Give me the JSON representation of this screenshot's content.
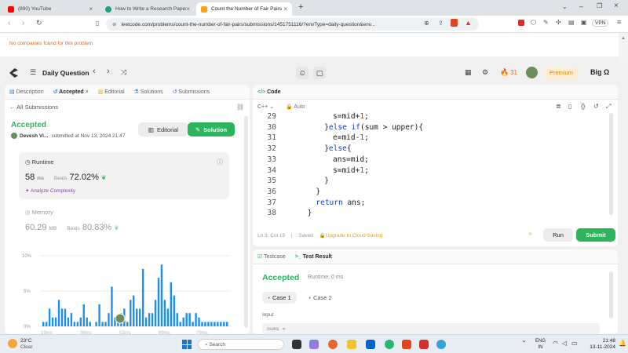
{
  "browser": {
    "tabs": [
      {
        "title": "(890) YouTube"
      },
      {
        "title": "How to Write a Research Paper: A S"
      },
      {
        "title": "Count the Number of Fair Pairs"
      }
    ],
    "url": "leetcode.com/problems/count-the-number-of-fair-pairs/submissions/1451751116/?envType=daily-question&env..."
  },
  "notice": "No companies found for this problem",
  "nav": {
    "daily_question": "Daily Question",
    "streak": "31",
    "premium": "Premium",
    "user": "Big Ω"
  },
  "left_panel": {
    "tabs": [
      "Description",
      "Accepted",
      "Editorial",
      "Solutions",
      "Submissions"
    ],
    "all_submissions": "All Submissions",
    "status": "Accepted",
    "author": "Devesh Vi...",
    "submitted_at": "submitted at Nov 13, 2024 21:47",
    "editorial_btn": "Editorial",
    "solution_btn": "Solution",
    "runtime_label": "Runtime",
    "runtime_value": "58",
    "runtime_unit": "ms",
    "beats_label": "Beats",
    "runtime_beats": "72.02%",
    "analyze": "Analyze Complexity",
    "memory_label": "Memory",
    "memory_value": "60.29",
    "memory_unit": "MB",
    "memory_beats": "80.83%",
    "y_ticks": [
      "10%",
      "5%",
      "0%"
    ],
    "x_ticks": [
      "19ms",
      "36ms",
      "53ms",
      "69ms",
      "79ms"
    ]
  },
  "chart_data": {
    "type": "bar",
    "values": [
      1,
      1,
      4,
      2,
      2,
      6,
      4,
      4,
      2,
      3,
      1,
      1,
      2,
      5,
      2,
      1,
      0,
      1,
      5,
      1,
      1,
      3,
      9,
      2,
      1,
      3,
      4,
      1,
      6,
      7,
      4,
      4,
      13,
      2,
      3,
      3,
      6,
      11,
      14,
      6,
      4,
      10,
      7,
      3,
      1,
      2,
      3,
      3,
      1,
      3,
      2,
      1,
      1,
      1,
      1,
      1,
      1,
      1,
      1,
      1
    ],
    "ylim": [
      0,
      16
    ]
  },
  "code_panel": {
    "title": "Code",
    "language": "C++",
    "mode": "Auto",
    "lines": [
      {
        "n": "29",
        "indent": 10,
        "text": "s=mid+1;"
      },
      {
        "n": "30",
        "indent": 8,
        "text": "}else if(sum > upper){"
      },
      {
        "n": "31",
        "indent": 10,
        "text": "e=mid-1;"
      },
      {
        "n": "32",
        "indent": 8,
        "text": "}else{"
      },
      {
        "n": "33",
        "indent": 10,
        "text": "ans=mid;"
      },
      {
        "n": "34",
        "indent": 10,
        "text": "s=mid+1;"
      },
      {
        "n": "35",
        "indent": 8,
        "text": "}"
      },
      {
        "n": "36",
        "indent": 6,
        "text": "}"
      },
      {
        "n": "37",
        "indent": 6,
        "text": "return ans;"
      },
      {
        "n": "38",
        "indent": 4,
        "text": "}"
      }
    ],
    "cursor": "Ln 3, Col 19",
    "saved": "Saved",
    "upgrade": "Upgrade to Cloud Saving",
    "run": "Run",
    "submit": "Submit"
  },
  "result_panel": {
    "testcase_tab": "Testcase",
    "result_tab": "Test Result",
    "status": "Accepted",
    "runtime": "Runtime: 0 ms",
    "cases": [
      "Case 1",
      "Case 2"
    ],
    "input_label": "Input",
    "input_var": "nums ="
  },
  "taskbar": {
    "temp": "23°C",
    "weather": "Clear",
    "search": "Search",
    "lang1": "ENG",
    "lang2": "IN",
    "time": "21:48",
    "date": "13-11-2024"
  },
  "colors": {
    "accent_green": "#2db55d",
    "brand_orange": "#ffa116",
    "bar_blue": "#1f8ef1"
  }
}
